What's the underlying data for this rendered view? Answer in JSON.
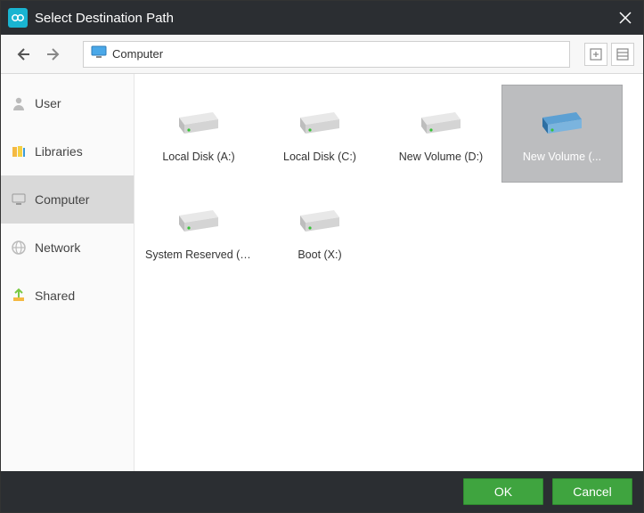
{
  "title": "Select Destination Path",
  "toolbar": {
    "breadcrumb": "Computer"
  },
  "sidebar": {
    "items": [
      {
        "label": "User"
      },
      {
        "label": "Libraries"
      },
      {
        "label": "Computer"
      },
      {
        "label": "Network"
      },
      {
        "label": "Shared"
      }
    ],
    "selected_index": 2
  },
  "drives": [
    {
      "label": "Local Disk (A:)",
      "selected": false
    },
    {
      "label": "Local Disk (C:)",
      "selected": false
    },
    {
      "label": "New Volume (D:)",
      "selected": false
    },
    {
      "label": "New Volume (...",
      "selected": true
    },
    {
      "label": "System Reserved (G:)",
      "selected": false
    },
    {
      "label": "Boot (X:)",
      "selected": false
    }
  ],
  "buttons": {
    "ok": "OK",
    "cancel": "Cancel"
  }
}
